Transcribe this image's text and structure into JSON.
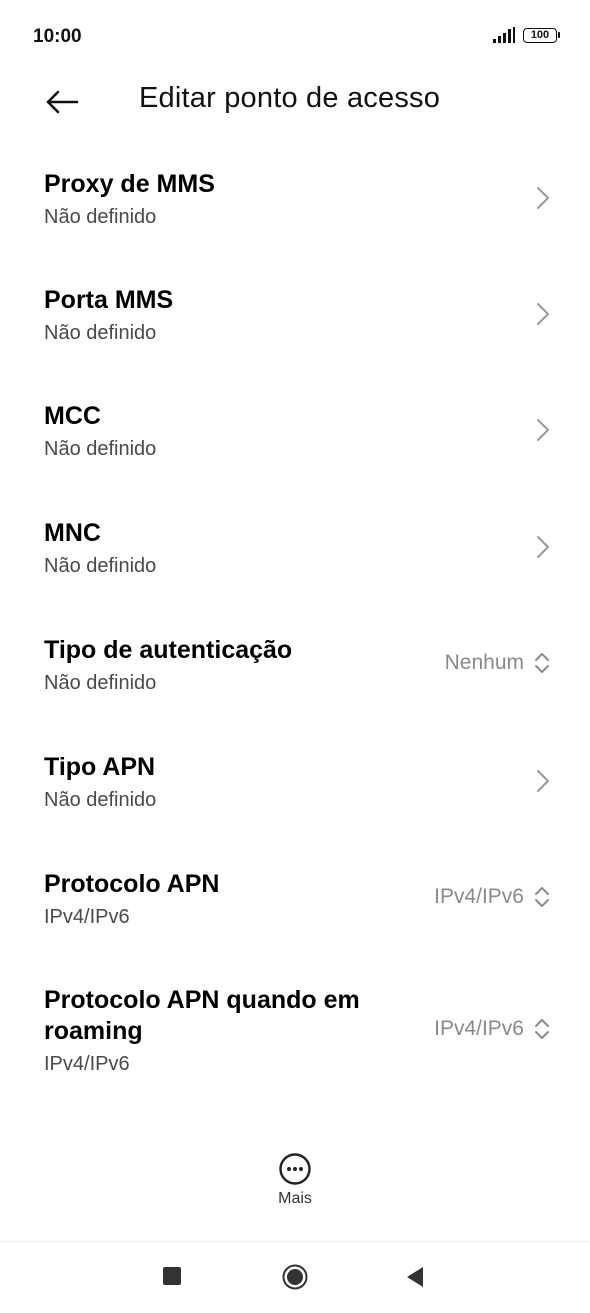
{
  "status_bar": {
    "time": "10:00",
    "battery_level": "100",
    "icons": [
      "signal-icon",
      "battery-icon"
    ]
  },
  "header": {
    "title": "Editar ponto de acesso",
    "back_icon": "arrow-left-icon"
  },
  "rows": [
    {
      "title": "Proxy de MMS",
      "subtitle": "Não definido",
      "control": "chevron"
    },
    {
      "title": "Porta MMS",
      "subtitle": "Não definido",
      "control": "chevron"
    },
    {
      "title": "MCC",
      "subtitle": "Não definido",
      "control": "chevron"
    },
    {
      "title": "MNC",
      "subtitle": "Não definido",
      "control": "chevron"
    },
    {
      "title": "Tipo de autenticação",
      "subtitle": "Não definido",
      "control": "dropdown",
      "value": "Nenhum"
    },
    {
      "title": "Tipo APN",
      "subtitle": "Não definido",
      "control": "chevron"
    },
    {
      "title": "Protocolo APN",
      "subtitle": "IPv4/IPv6",
      "control": "dropdown",
      "value": "IPv4/IPv6"
    },
    {
      "title": "Protocolo APN quando em roaming",
      "subtitle": "IPv4/IPv6",
      "control": "dropdown",
      "value": "IPv4/IPv6"
    }
  ],
  "more": {
    "label": "Mais",
    "icon": "more-horizontal-icon"
  },
  "nav": {
    "icons": [
      "recents-icon",
      "home-icon",
      "back-triangle-icon"
    ]
  },
  "colors": {
    "title_text": "#000000",
    "subtitle_text": "#4a4a4a",
    "value_text": "#8a8a8a",
    "chevron": "#9a9a9a",
    "background": "#ffffff"
  }
}
